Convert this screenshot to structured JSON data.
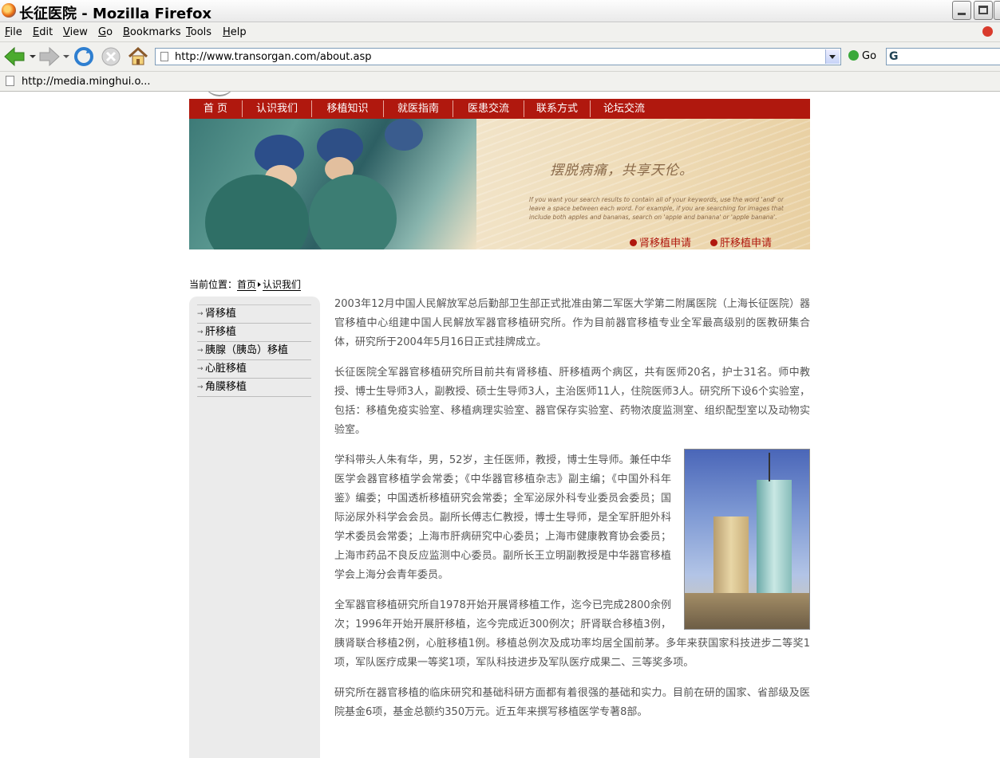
{
  "window": {
    "title": "长征医院 - Mozilla Firefox"
  },
  "menubar": {
    "items": [
      "File",
      "Edit",
      "View",
      "Go",
      "Bookmarks",
      "Tools",
      "Help"
    ]
  },
  "navbar": {
    "url": "http://www.transorgan.com/about.asp",
    "go_label": "Go"
  },
  "bookmarks": {
    "item": "http://media.minghui.o..."
  },
  "site": {
    "nav": [
      "首 页",
      "认识我们",
      "移植知识",
      "就医指南",
      "医患交流",
      "联系方式",
      "论坛交流"
    ],
    "banner": {
      "slogan": "摆脱病痛，共享天伦。",
      "small_text": "If you want your search results to contain all of your keywords, use the word 'and' or leave a space between each word. For example, if you are searching for images that include both apples and bananas, search on 'apple and banana' or 'apple banana'.",
      "link_kidney": "肾移植申请",
      "link_liver": "肝移植申请"
    },
    "breadcrumb": {
      "prefix": "当前位置：",
      "home": "首页",
      "current": "认识我们"
    },
    "sidebar": [
      "肾移植",
      "肝移植",
      "胰腺（胰岛）移植",
      "心脏移植",
      "角膜移植"
    ],
    "paragraphs": [
      "2003年12月中国人民解放军总后勤部卫生部正式批准由第二军医大学第二附属医院（上海长征医院）器官移植中心组建中国人民解放军器官移植研究所。作为目前器官移植专业全军最高级别的医教研集合体，研究所于2004年5月16日正式挂牌成立。",
      "长征医院全军器官移植研究所目前共有肾移植、肝移植两个病区，共有医师20名，护士31名。师中教授、博士生导师3人，副教授、硕士生导师3人，主治医师11人，住院医师3人。研究所下设6个实验室，包括：移植免疫实验室、移植病理实验室、器官保存实验室、药物浓度监测室、组织配型室以及动物实验室。",
      "学科带头人朱有华，男，52岁，主任医师，教授，博士生导师。兼任中华医学会器官移植学会常委；《中华器官移植杂志》副主编；《中国外科年鉴》编委；中国透析移植研究会常委；全军泌尿外科专业委员会委员；国际泌尿外科学会会员。副所长傅志仁教授，博士生导师，是全军肝胆外科学术委员会常委；上海市肝病研究中心委员；上海市健康教育协会委员；上海市药品不良反应监测中心委员。副所长王立明副教授是中华器官移植学会上海分会青年委员。",
      "全军器官移植研究所自1978开始开展肾移植工作，迄今已完成2800余例次；1996年开始开展肝移植，迄今完成近300例次；肝肾联合移植3例，胰肾联合移植2例，心脏移植1例。移植总例次及成功率均居全国前茅。多年来获国家科技进步二等奖1项，军队医疗成果一等奖1项，军队科技进步及军队医疗成果二、三等奖多项。",
      "研究所在器官移植的临床研究和基础科研方面都有着很强的基础和实力。目前在研的国家、省部级及医院基金6项，基金总额约350万元。近五年来撰写移植医学专著8部。"
    ]
  }
}
